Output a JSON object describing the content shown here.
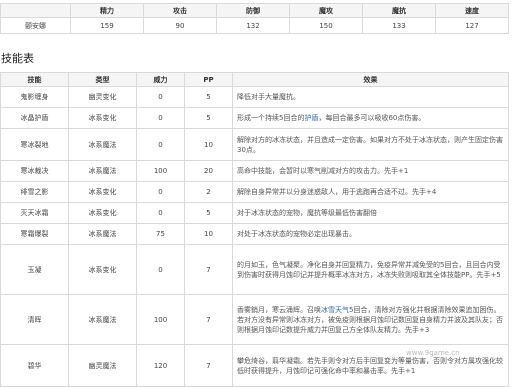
{
  "stats": {
    "headers": [
      "",
      "精力",
      "攻击",
      "防御",
      "魔攻",
      "魔抗",
      "速度"
    ],
    "row": [
      "颤安娜",
      "159",
      "90",
      "132",
      "150",
      "133",
      "127"
    ]
  },
  "section_title": "技能表",
  "skills": {
    "headers": [
      "技能",
      "类型",
      "威力",
      "PP",
      "效果"
    ],
    "rows": [
      {
        "name": "鬼影缠身",
        "type": "幽灵变化",
        "power": "0",
        "pp": "5",
        "pre": "降低对手大量魔抗。",
        "link": "",
        "post": ""
      },
      {
        "name": "冰晶护盾",
        "type": "冰系变化",
        "power": "0",
        "pp": "5",
        "pre": "形成一个持续5回合的",
        "link": "护盾",
        "post": "，每回合最多可以吸收60点伤害。"
      },
      {
        "name": "寒冰裂地",
        "type": "冰系魔法",
        "power": "0",
        "pp": "10",
        "pre": "解除对方的冰冻状态，并且造成一定伤害。如果对方不处于冰冻状态，则产生固定伤害30点。",
        "link": "",
        "post": ""
      },
      {
        "name": "寒冰裁决",
        "type": "冰系魔法",
        "power": "100",
        "pp": "20",
        "pre": "高命中技能，会暂时以寒气削减对方的攻击力。先手+1",
        "link": "",
        "post": ""
      },
      {
        "name": "绯雪之影",
        "type": "冰系变化",
        "power": "0",
        "pp": "2",
        "pre": "解除自身异常并以分身迷惑敌人，用于逃跑再合适不过。先手+4",
        "link": "",
        "post": ""
      },
      {
        "name": "灭天冰霜",
        "type": "冰系变化",
        "power": "0",
        "pp": "5",
        "pre": "对于冰冻状态的宠物，魔抗等级最低伤害翻倍",
        "link": "",
        "post": ""
      },
      {
        "name": "寒霜爆裂",
        "type": "冰系魔法",
        "power": "75",
        "pp": "10",
        "pre": "对处于冰冻状态的宠物必定出现暴击。",
        "link": "",
        "post": ""
      },
      {
        "name": "玉凝",
        "type": "冰系变化",
        "power": "0",
        "pp": "7",
        "pre": "的月如玉，色气凝聚。净化自身并回复精力，免疫异常并减免受的5回合，且回合内受到伤害时获得月蚀印记并提升概率冰冻对方，冰冻失败则吸取其全体技能PP。先手+5",
        "link": "",
        "post": ""
      },
      {
        "name": "清晖",
        "type": "冰系魔法",
        "power": "100",
        "pp": "7",
        "pre": "香雾銷月，寒云涌辉。召唤",
        "link": "冰雪天气",
        "post": "5回合，清除对方强化并根据清除效果追加困伤。若对方没有异常则冰冻对方，被免疫则根据月蚀印记数回复自身精力并波及其队友；否则根据月蚀印记数提升威力并回复己方全体队友精力。先手+3"
      },
      {
        "name": "碧华",
        "type": "幽灵魔法",
        "power": "120",
        "pp": "7",
        "pre": "攀危绮谷，翦华凝霜。若先手则令对方后手回复变为等量伤害，否则令对方属攻强化较低时获得提升，月蚀印记可强化命中率和暴击率。先手+1",
        "link": "",
        "post": ""
      }
    ]
  },
  "watermark": "www.9game.cn"
}
